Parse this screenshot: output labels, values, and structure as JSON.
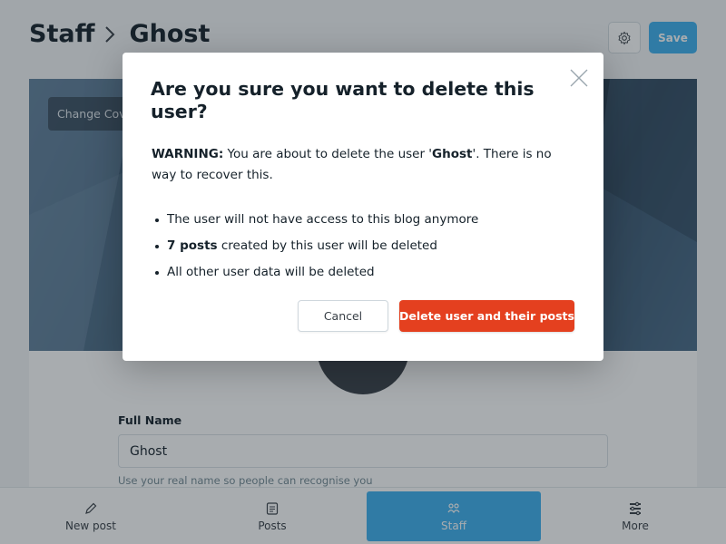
{
  "header": {
    "breadcrumb_parent": "Staff",
    "breadcrumb_current": "Ghost",
    "save_label": "Save"
  },
  "cover": {
    "change_cover_label": "Change Cover"
  },
  "profile": {
    "full_name_label": "Full Name",
    "full_name_value": "Ghost",
    "full_name_help": "Use your real name so people can recognise you"
  },
  "bottom_nav": {
    "items": [
      {
        "label": "New post",
        "icon": "pencil-icon"
      },
      {
        "label": "Posts",
        "icon": "document-icon"
      },
      {
        "label": "Staff",
        "icon": "staff-icon",
        "active": true
      },
      {
        "label": "More",
        "icon": "more-icon"
      }
    ]
  },
  "modal": {
    "title": "Are you sure you want to delete this user?",
    "warning_prefix": "WARNING:",
    "warning_text_1": " You are about to delete the user '",
    "warning_user": "Ghost",
    "warning_text_2": "'. There is no way to recover this.",
    "bullet_1": "The user will not have access to this blog anymore",
    "bullet_2_count": "7 posts",
    "bullet_2_rest": " created by this user will be deleted",
    "bullet_3": "All other user data will be deleted",
    "cancel_label": "Cancel",
    "delete_label": "Delete user and their posts"
  },
  "colors": {
    "accent": "#3eb0ef",
    "danger": "#e4401f",
    "text": "#15212a"
  }
}
